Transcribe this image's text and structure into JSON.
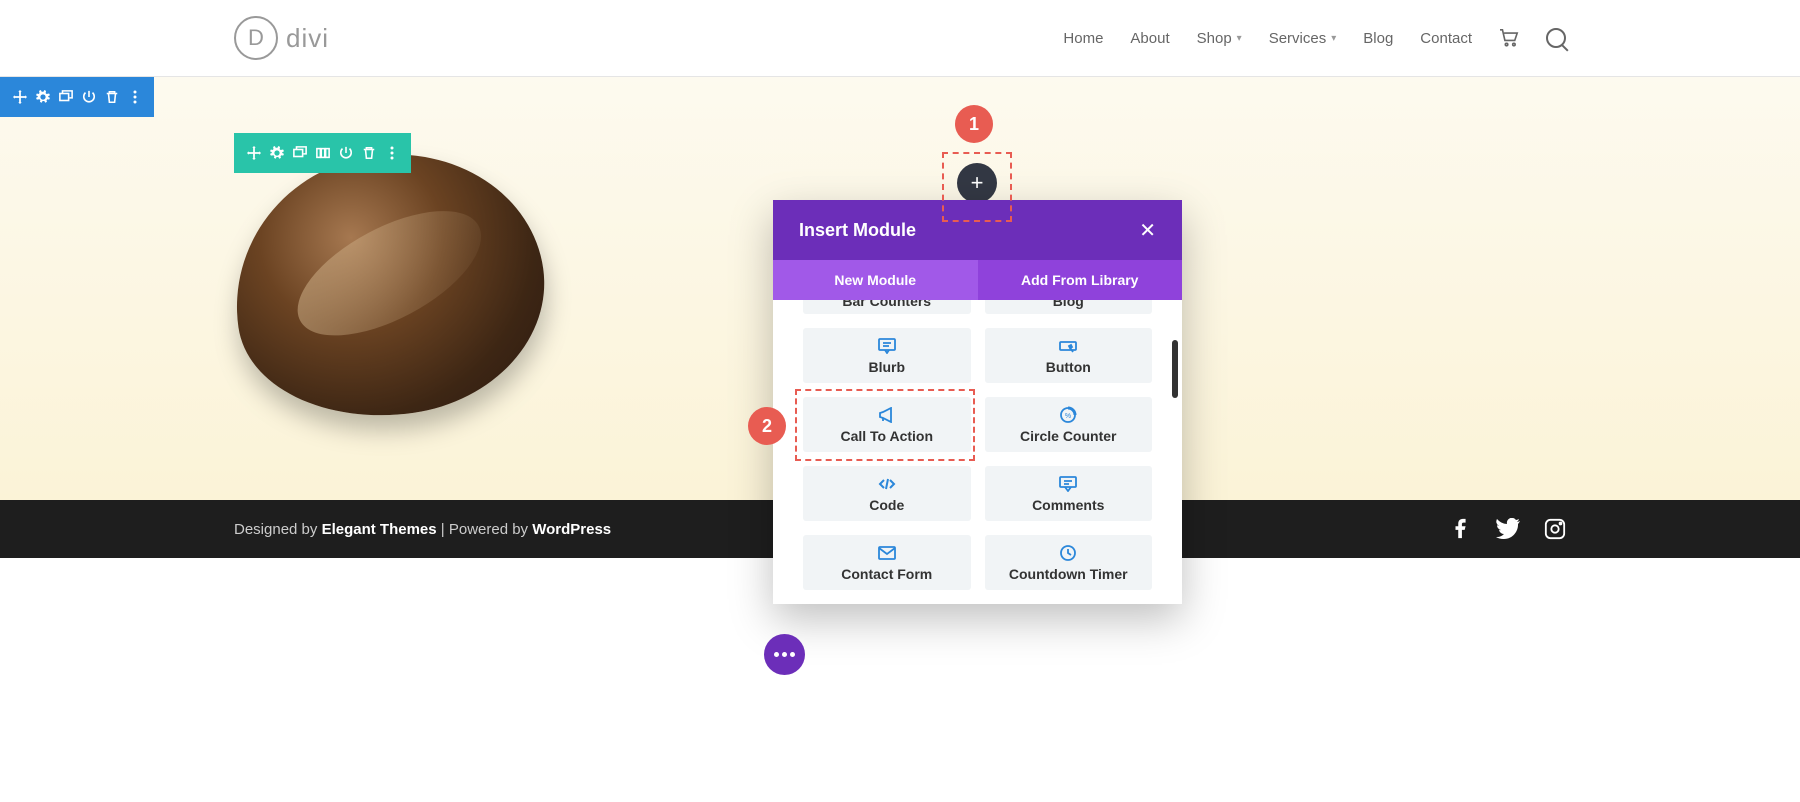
{
  "header": {
    "logo_text": "divi",
    "nav": [
      "Home",
      "About",
      "Shop",
      "Services",
      "Blog",
      "Contact"
    ],
    "nav_dropdown": [
      false,
      false,
      true,
      true,
      false,
      false
    ]
  },
  "section_toolbar_icons": [
    "move-icon",
    "gear-icon",
    "duplicate-icon",
    "power-icon",
    "trash-icon",
    "more-vertical-icon"
  ],
  "row_toolbar_icons": [
    "move-icon",
    "gear-icon",
    "duplicate-icon",
    "columns-icon",
    "power-icon",
    "trash-icon",
    "more-vertical-icon"
  ],
  "callouts": {
    "one": "1",
    "two": "2"
  },
  "plus_label": "+",
  "modal": {
    "title": "Insert Module",
    "tab_new": "New Module",
    "tab_library": "Add From Library",
    "cut_items": [
      "Bar Counters",
      "Blog"
    ],
    "modules": [
      {
        "label": "Blurb",
        "icon": "blurb"
      },
      {
        "label": "Button",
        "icon": "button"
      },
      {
        "label": "Call To Action",
        "icon": "megaphone"
      },
      {
        "label": "Circle Counter",
        "icon": "circle-counter"
      },
      {
        "label": "Code",
        "icon": "code"
      },
      {
        "label": "Comments",
        "icon": "comments"
      },
      {
        "label": "Contact Form",
        "icon": "envelope"
      },
      {
        "label": "Countdown Timer",
        "icon": "clock"
      }
    ]
  },
  "footer": {
    "prefix": "Designed by ",
    "link1": "Elegant Themes",
    "mid": " | Powered by ",
    "link2": "WordPress"
  }
}
